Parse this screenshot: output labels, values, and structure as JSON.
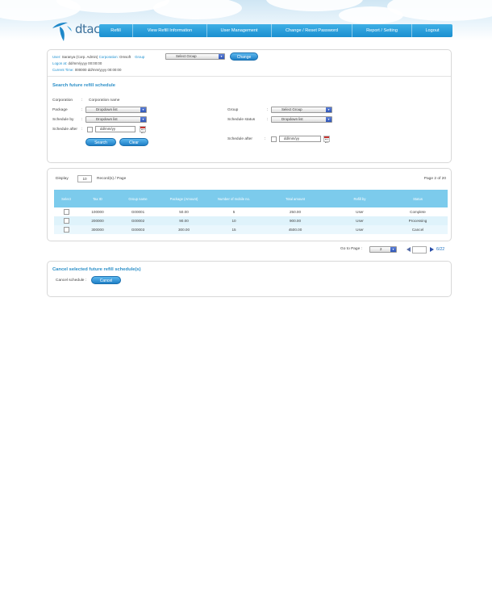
{
  "brand": {
    "name": "dtac"
  },
  "nav": [
    "Refill",
    "View Refill Information",
    "User Management",
    "Change / Reset Password",
    "Report / Setting",
    "Logout"
  ],
  "user_info": {
    "user_label": "User:",
    "user_value": "Saranya (Corp. Admin)",
    "corporation_label": "Corporation:",
    "corporation_value": "Omsoft",
    "group_label": "Group",
    "group_select": "Select Group",
    "change_button": "Change",
    "logon_label": "Logon at:",
    "logon_value": "dd/mm/yyyy 00:00:00",
    "current_time_label": "Current Time:",
    "current_time_value": "000000 dd/mm/yyyy 00:00:00"
  },
  "search": {
    "title": "Search future refill schedule",
    "corporation_label": "Corporation",
    "corporation_value": "Corporation name",
    "package_label": "Package",
    "package_value": "Dropdown list",
    "schedule_by_label": "Schedule by",
    "schedule_by_value": "Dropdown list",
    "schedule_after_label": "Schedule after",
    "date_placeholder": "dd/mm/yy",
    "group_label": "Group",
    "group_value": "Select Group",
    "schedule_status_label": "Schedule status",
    "schedule_status_value": "Dropdown list",
    "schedule_after_right_label": "Schedule after",
    "search_button": "Search",
    "clear_button": "Clear"
  },
  "results": {
    "display_label": "Display",
    "display_value": "10",
    "records_label": "Record(s) / Page",
    "page_info": "Page 2 of 20",
    "columns": [
      "Select",
      "Tax ID",
      "Group name",
      "Package (Amount)",
      "Number of mobile no.",
      "Total amount",
      "Refill by",
      "Status"
    ],
    "rows": [
      [
        "100000",
        "G00001",
        "50.00",
        "5",
        "250.00",
        "User",
        "Complete"
      ],
      [
        "200000",
        "G00002",
        "90.00",
        "10",
        "900.00",
        "User",
        "Processing"
      ],
      [
        "300000",
        "G00003",
        "300.00",
        "15",
        "4500.00",
        "User",
        "Cancel"
      ]
    ]
  },
  "pager": {
    "goto_label": "Go to Page :",
    "goto_value": "2",
    "page_indicator": "6/22"
  },
  "cancel": {
    "title": "Cancel selected future refill schedule(s)",
    "label": "Cancel schedule :",
    "button": "Cancel"
  },
  "colors": {
    "accent": "#1a8fd0",
    "header": "#7ccbec",
    "nav": "#2ba2de"
  }
}
